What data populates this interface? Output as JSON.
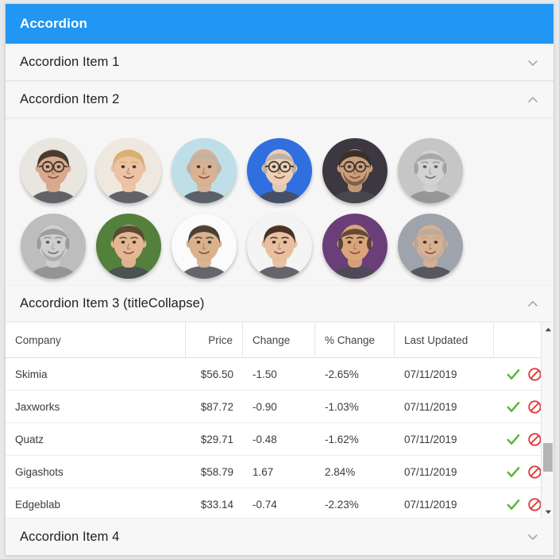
{
  "window": {
    "title": "Accordion",
    "header_color": "#2196f3"
  },
  "accordion": {
    "items": [
      {
        "label": "Accordion Item 1",
        "chevron": "chevron-down-icon",
        "expanded": false
      },
      {
        "label": "Accordion Item 2",
        "chevron": "chevron-up-icon",
        "expanded": true
      },
      {
        "label": "Accordion Item 3 (titleCollapse)",
        "chevron": "chevron-up-icon",
        "expanded": true
      },
      {
        "label": "Accordion Item 4",
        "chevron": "chevron-down-icon",
        "expanded": false
      }
    ]
  },
  "avatars": {
    "columns": 6,
    "people": [
      {
        "name": "avatar-man-glasses-phone",
        "skin": "#d8a98c",
        "hair": "#4a3a30",
        "bg": "#e9e6e0",
        "grayscale": false,
        "glasses": true,
        "bald": false,
        "beard": false
      },
      {
        "name": "avatar-woman-blonde",
        "skin": "#edc3a6",
        "hair": "#d8b173",
        "bg": "#efe8df",
        "grayscale": false,
        "glasses": false,
        "bald": false,
        "beard": false
      },
      {
        "name": "avatar-man-gray-hair",
        "skin": "#d9b293",
        "hair": "#b9b2ab",
        "bg": "#bfdfe8",
        "grayscale": false,
        "glasses": false,
        "bald": true,
        "beard": false
      },
      {
        "name": "avatar-man-blue-backdrop",
        "skin": "#eccfb4",
        "hair": "#b0aba4",
        "bg": "#2f6fe0",
        "grayscale": false,
        "glasses": true,
        "bald": true,
        "beard": false
      },
      {
        "name": "avatar-man-dark-portrait",
        "skin": "#c99d78",
        "hair": "#3a3028",
        "bg": "#3c3740",
        "grayscale": false,
        "glasses": true,
        "bald": false,
        "beard": true
      },
      {
        "name": "avatar-man-bw-smiling",
        "skin": "#d2d2d2",
        "hair": "#9a9a9a",
        "bg": "#c6c6c6",
        "grayscale": true,
        "glasses": false,
        "bald": true,
        "beard": false
      },
      {
        "name": "avatar-man-bw-mustache",
        "skin": "#cfcfcf",
        "hair": "#8e8e8e",
        "bg": "#bdbdbd",
        "grayscale": true,
        "glasses": false,
        "bald": true,
        "beard": true
      },
      {
        "name": "avatar-man-green-backdrop",
        "skin": "#e4b793",
        "hair": "#5b4a35",
        "bg": "#55803c",
        "grayscale": false,
        "glasses": false,
        "bald": false,
        "beard": false
      },
      {
        "name": "avatar-man-white-backdrop",
        "skin": "#d9b28d",
        "hair": "#4b4038",
        "bg": "#fbfbfb",
        "grayscale": false,
        "glasses": false,
        "bald": false,
        "beard": false
      },
      {
        "name": "avatar-man-young-smiling",
        "skin": "#e8c0a0",
        "hair": "#4a3326",
        "bg": "#f4f4f4",
        "grayscale": false,
        "glasses": false,
        "bald": false,
        "beard": false
      },
      {
        "name": "avatar-man-suit-purple",
        "skin": "#dba57a",
        "hair": "#3b2e24",
        "bg": "#6a3f79",
        "grayscale": false,
        "glasses": false,
        "bald": true,
        "beard": false
      },
      {
        "name": "avatar-man-bald-gray",
        "skin": "#d8b094",
        "hair": "#b4a99c",
        "bg": "#9fa3ab",
        "grayscale": false,
        "glasses": false,
        "bald": true,
        "beard": true
      },
      {
        "name": "avatar-man-row3-a",
        "skin": "#c9a07b",
        "hair": "#2a2118",
        "bg": "#233a66",
        "grayscale": false,
        "glasses": false,
        "bald": false,
        "beard": false
      },
      {
        "name": "avatar-man-row3-b",
        "skin": "#e0b593",
        "hair": "#cbb8a4",
        "bg": "#ededed",
        "grayscale": false,
        "glasses": false,
        "bald": true,
        "beard": false
      },
      {
        "name": "avatar-man-row3-c",
        "skin": "#d6ab85",
        "hair": "#2f2a24",
        "bg": "#f2f2f2",
        "grayscale": false,
        "glasses": false,
        "bald": false,
        "beard": false
      },
      {
        "name": "avatar-man-row3-d",
        "skin": "#c08a5e",
        "hair": "#5a4430",
        "bg": "#efefef",
        "grayscale": false,
        "glasses": false,
        "bald": true,
        "beard": false
      },
      {
        "name": "avatar-man-row3-e",
        "skin": "#f0cdae",
        "hair": "#e3c9ae",
        "bg": "#f1f1f1",
        "grayscale": false,
        "glasses": false,
        "bald": true,
        "beard": false
      },
      {
        "name": "avatar-man-row3-f",
        "skin": "#c79a72",
        "hair": "#241d16",
        "bg": "#2e4a8a",
        "grayscale": false,
        "glasses": false,
        "bald": false,
        "beard": false
      }
    ]
  },
  "table": {
    "columns": [
      "Company",
      "Price",
      "Change",
      "% Change",
      "Last Updated",
      ""
    ],
    "rows": [
      {
        "company": "Skimia",
        "price": "$56.50",
        "change": "-1.50",
        "pct": "-2.65%",
        "updated": "07/11/2019",
        "direction": "down"
      },
      {
        "company": "Jaxworks",
        "price": "$87.72",
        "change": "-0.90",
        "pct": "-1.03%",
        "updated": "07/11/2019",
        "direction": "down"
      },
      {
        "company": "Quatz",
        "price": "$29.71",
        "change": "-0.48",
        "pct": "-1.62%",
        "updated": "07/11/2019",
        "direction": "down"
      },
      {
        "company": "Gigashots",
        "price": "$58.79",
        "change": "1.67",
        "pct": "2.84%",
        "updated": "07/11/2019",
        "direction": "up"
      },
      {
        "company": "Edgeblab",
        "price": "$33.14",
        "change": "-0.74",
        "pct": "-2.23%",
        "updated": "07/11/2019",
        "direction": "down"
      }
    ],
    "row_actions": [
      "approve-check-icon",
      "block-ban-icon"
    ],
    "colors": {
      "negative": "#e05252",
      "positive": "#67b23a",
      "check": "#5cb531",
      "ban": "#e03b3b"
    }
  },
  "scrollbar": {
    "up_arrow": "scroll-up-arrow-icon",
    "down_arrow": "scroll-down-arrow-icon",
    "thumb": "scroll-thumb"
  }
}
